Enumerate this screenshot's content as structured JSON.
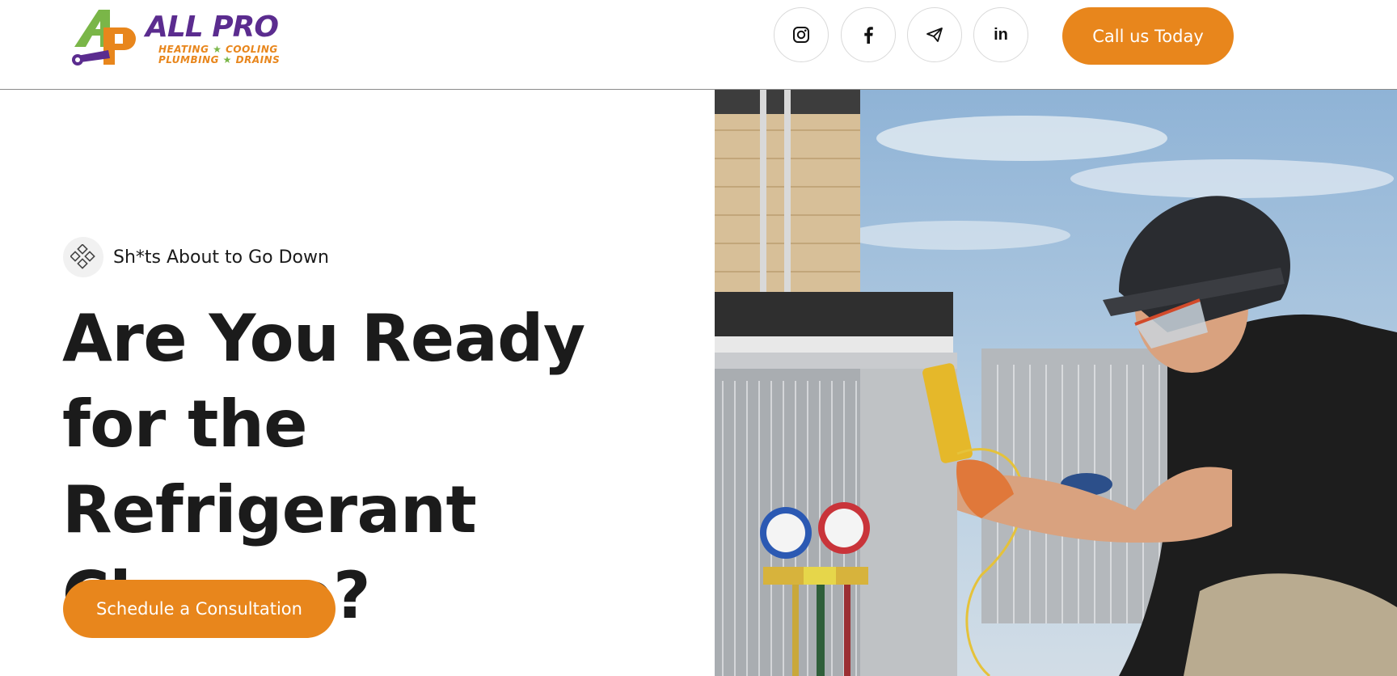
{
  "brand": {
    "name": "ALL PRO",
    "tagline_line1": "HEATING",
    "tagline_line1b": "COOLING",
    "tagline_line2": "PLUMBING",
    "tagline_line2b": "DRAINS",
    "colors": {
      "purple": "#5b2c8f",
      "orange": "#e8861c",
      "green": "#7ab648"
    }
  },
  "header": {
    "social": [
      {
        "name": "instagram",
        "icon": "instagram-icon"
      },
      {
        "name": "facebook",
        "icon": "facebook-icon"
      },
      {
        "name": "telegram",
        "icon": "send-icon"
      },
      {
        "name": "linkedin",
        "icon": "linkedin-icon",
        "glyph": "in"
      }
    ],
    "call_label": "Call us Today"
  },
  "hero": {
    "eyebrow_icon": "diamond-grid-icon",
    "eyebrow": "Sh*ts About to Go Down",
    "headline": "Are You Ready for the Refrigerant Change?",
    "cta_label": "Schedule a Consultation",
    "image": "hvac-technician-photo"
  },
  "colors": {
    "accent": "#e8861c",
    "text": "#1b1b1b"
  }
}
